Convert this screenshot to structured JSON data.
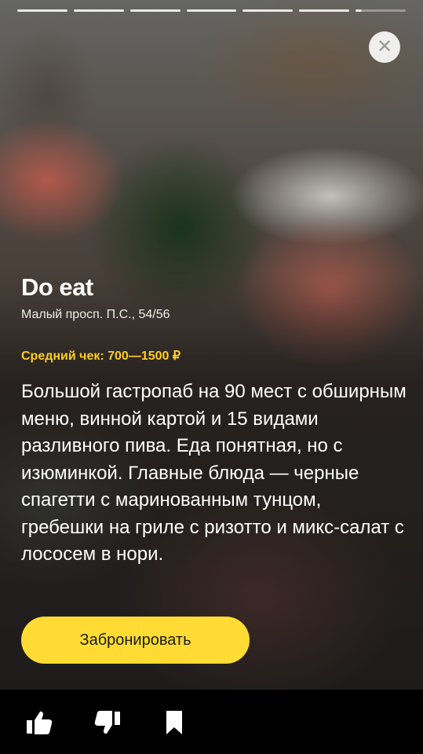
{
  "story": {
    "progress": {
      "segments": 7,
      "current": 7,
      "current_fill": 0.12
    },
    "close_icon": "close-icon"
  },
  "place": {
    "name": "Do eat",
    "address": "Малый просп. П.С., 54/56",
    "price": "Средний чек: 700—1500 ₽",
    "description": "Большой гастропаб на 90 мест с обширным меню, винной картой и 15 видами разливного пива. Еда понятная, но с изюминкой. Главные блюда — черные спагетти с маринованным тунцом, гребешки на гриле с ризотто и микс-салат с лососем в нори."
  },
  "actions": {
    "book_label": "Забронировать"
  },
  "bottom_bar": {
    "icons": [
      "like-icon",
      "dislike-icon",
      "bookmark-icon"
    ]
  },
  "colors": {
    "accent": "#ffdb33",
    "price_text": "#ffcc22",
    "bar": "#000000"
  }
}
